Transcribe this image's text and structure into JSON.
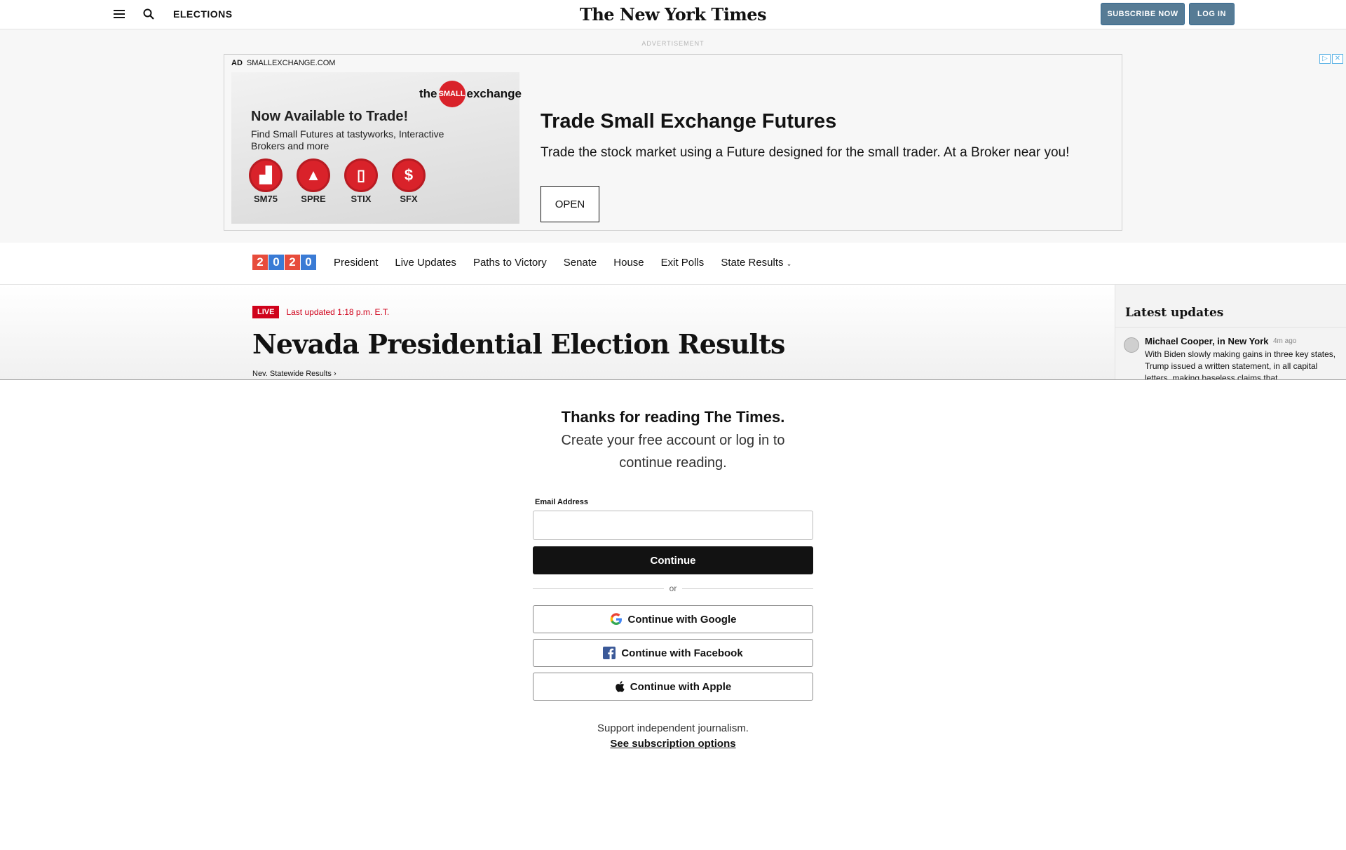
{
  "header": {
    "section": "ELECTIONS",
    "logo": "The New York Times",
    "subscribe": "SUBSCRIBE NOW",
    "login": "LOG IN"
  },
  "ad": {
    "label": "ADVERTISEMENT",
    "tag": "AD",
    "source": "SMALLEXCHANGE.COM",
    "brand_pre": "the",
    "brand_mid": "SMALL",
    "brand_post": "exchange",
    "image_title": "Now Available to Trade!",
    "image_sub": "Find Small Futures at tastyworks, Interactive Brokers and more",
    "products": [
      "SM75",
      "SPRE",
      "STIX",
      "SFX"
    ],
    "headline": "Trade Small Exchange Futures",
    "description": "Trade the stock market using a Future designed for the small trader. At a Broker near you!",
    "cta": "OPEN"
  },
  "nav": {
    "year_digits": [
      "2",
      "0",
      "2",
      "0"
    ],
    "items": [
      "President",
      "Live Updates",
      "Paths to Victory",
      "Senate",
      "House",
      "Exit Polls",
      "State Results"
    ]
  },
  "article": {
    "live": "LIVE",
    "updated": "Last updated 1:18 p.m. E.T.",
    "title": "Nevada Presidential Election Results",
    "breadcrumb": "Nev. Statewide Results ›"
  },
  "sidebar": {
    "title": "Latest updates",
    "author": "Michael Cooper, in New York",
    "time": "4m ago",
    "text": "With Biden slowly making gains in three key states, Trump issued a written statement, in all capital letters, making baseless claims that"
  },
  "paywall": {
    "title": "Thanks for reading The Times.",
    "sub_line1": "Create your free account or log in to",
    "sub_line2": "continue reading.",
    "email_label": "Email Address",
    "email_value": "",
    "continue": "Continue",
    "or": "or",
    "google": "Continue with Google",
    "facebook": "Continue with Facebook",
    "apple": "Continue with Apple",
    "support": "Support independent journalism.",
    "subscription_link": "See subscription options"
  },
  "colors": {
    "accent": "#567b95",
    "live_red": "#d0021b",
    "year_red": "#e74c3c",
    "year_blue": "#3a7bd5"
  }
}
